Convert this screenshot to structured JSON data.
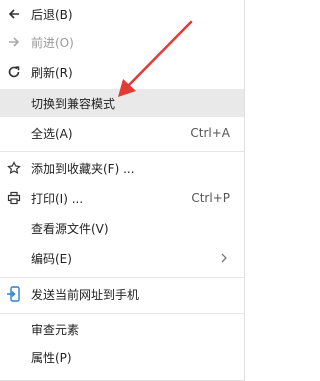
{
  "context_menu": {
    "items": [
      {
        "label": "后退(B)",
        "icon": "back-arrow-icon",
        "disabled": false
      },
      {
        "label": "前进(O)",
        "icon": "forward-arrow-icon",
        "disabled": true
      },
      {
        "label": "刷新(R)",
        "icon": "refresh-icon",
        "disabled": false
      },
      {
        "label": "切换到兼容模式",
        "icon": "",
        "disabled": false,
        "highlighted": true
      },
      {
        "label": "全选(A)",
        "shortcut": "Ctrl+A"
      },
      {
        "label": "添加到收藏夹(F) ...",
        "icon": "star-icon"
      },
      {
        "label": "打印(I) ...",
        "icon": "printer-icon",
        "shortcut": "Ctrl+P"
      },
      {
        "label": "查看源文件(V)"
      },
      {
        "label": "编码(E)",
        "submenu_icon": "chevron-right-icon"
      },
      {
        "label": "发送当前网址到手机",
        "icon": "send-to-phone-icon"
      },
      {
        "label": "审查元素"
      },
      {
        "label": "属性(P)"
      }
    ]
  },
  "colors": {
    "highlight": "#e9e9e9",
    "annotation_arrow": "#e53935",
    "phone_icon": "#2a7fd4",
    "disabled_text": "#9a9a9a"
  }
}
